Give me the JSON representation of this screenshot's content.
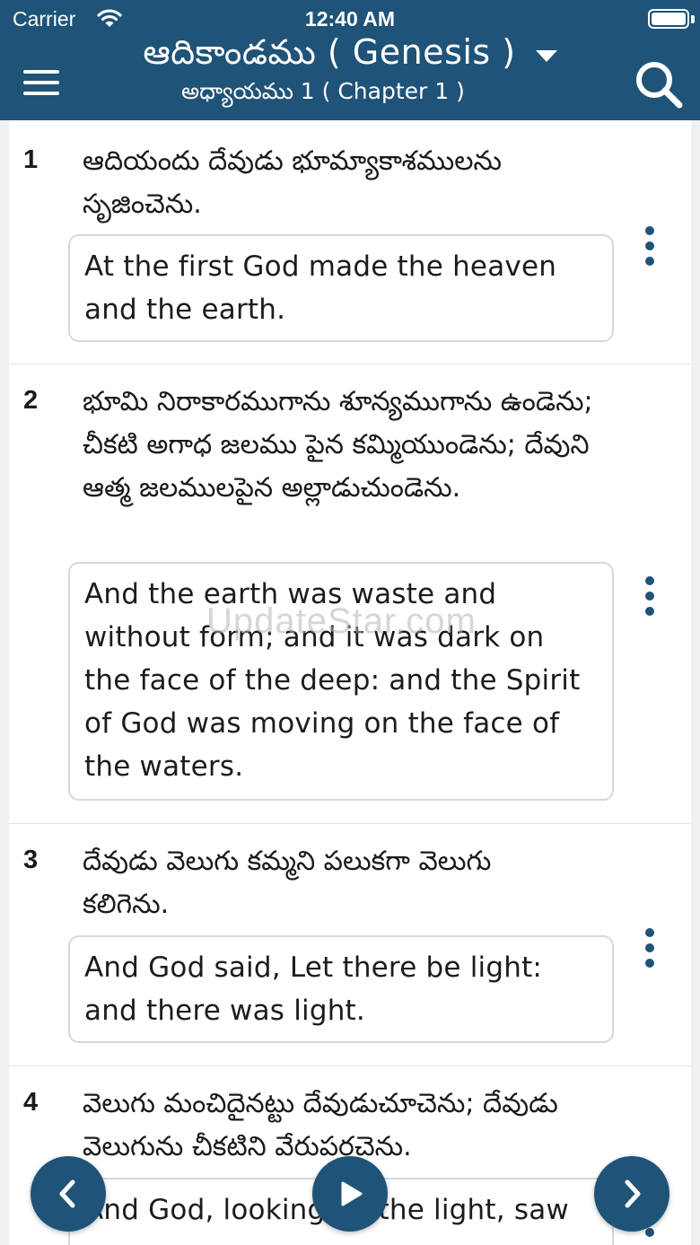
{
  "status_bar": {
    "carrier": "Carrier",
    "time": "12:40 AM"
  },
  "header": {
    "book_title": "ఆదికాండము ( Genesis )",
    "chapter_subtitle": "అధ్యాయము 1 ( Chapter 1 )"
  },
  "verses": [
    {
      "number": "1",
      "telugu": "ఆదియందు దేవుడు భూమ్యాకాశములను సృజించెను.",
      "english": "At the first God made the heaven and the earth."
    },
    {
      "number": "2",
      "telugu": "భూమి నిరాకారముగాను శూన్యముగాను ఉండెను; చీకటి అగాధ జలము పైన కమ్మియుండెను; దేవుని ఆత్మ జలములపైన అల్లాడుచుండెను.",
      "english": "And the earth was waste and without form; and it was dark on the face of the deep: and the Spirit of God was moving on the face of the waters."
    },
    {
      "number": "3",
      "telugu": "దేవుడు వెలుగు కమ్మని పలుకగా వెలుగు కలిగెను.",
      "english": "And God said, Let there be light: and there was light."
    },
    {
      "number": "4",
      "telugu": "వెలుగు మంచిదైనట్టు దేవుడుచూచెను; దేవుడు వెలుగును చీకటిని వేరుపరచెను.",
      "english": "And God, looking on the light, saw"
    }
  ],
  "watermark": "UpdateStar.com",
  "icons": {
    "menu": "hamburger-icon",
    "dropdown": "caret-down-icon",
    "search": "search-icon",
    "more": "vertical-dots-icon",
    "prev": "chevron-left-icon",
    "play": "play-icon",
    "next": "chevron-right-icon"
  },
  "colors": {
    "primary": "#1f5378",
    "background": "#eef0f2",
    "card": "#ffffff"
  }
}
